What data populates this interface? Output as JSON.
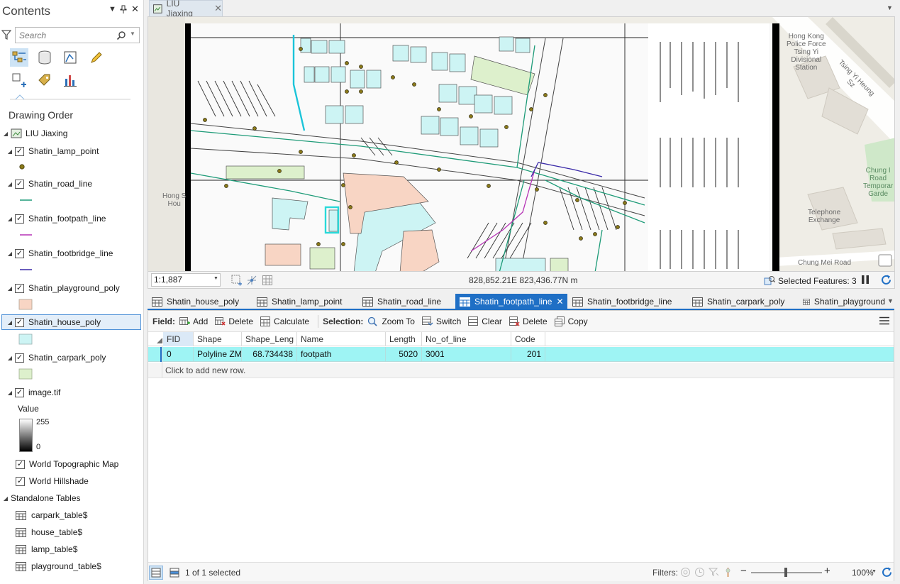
{
  "contents": {
    "title": "Contents",
    "search_placeholder": "Search",
    "drawing_order_label": "Drawing Order",
    "map_name": "LIU Jiaxing",
    "layers": [
      {
        "label": "Shatin_lamp_point",
        "checked": true,
        "symbol": "point",
        "color": "#8b7a1a"
      },
      {
        "label": "Shatin_road_line",
        "checked": true,
        "symbol": "line",
        "color": "#1e9b78"
      },
      {
        "label": "Shatin_footpath_line",
        "checked": true,
        "symbol": "line",
        "color": "#b532b5"
      },
      {
        "label": "Shatin_footbridge_line",
        "checked": true,
        "symbol": "line",
        "color": "#3a2aa8"
      },
      {
        "label": "Shatin_playground_poly",
        "checked": true,
        "symbol": "fill",
        "color": "#f8d5c4"
      },
      {
        "label": "Shatin_house_poly",
        "checked": true,
        "symbol": "fill",
        "color": "#cdf4f4",
        "selected": true
      },
      {
        "label": "Shatin_carpark_poly",
        "checked": true,
        "symbol": "fill",
        "color": "#ddf0cc"
      },
      {
        "label": "image.tif",
        "checked": true,
        "symbol": "raster"
      }
    ],
    "raster_legend": {
      "title": "Value",
      "high": "255",
      "low": "0"
    },
    "basemaps": [
      {
        "label": "World Topographic Map",
        "checked": true
      },
      {
        "label": "World Hillshade",
        "checked": true
      }
    ],
    "standalone_tables_label": "Standalone Tables",
    "tables": [
      "carpark_table$",
      "house_table$",
      "lamp_table$",
      "playground_table$"
    ]
  },
  "map": {
    "tab_label": "LIU Jiaxing",
    "scale": "1:1,887",
    "coordinates": "828,852.21E 823,436.77N m",
    "selected_features": "Selected Features: 3",
    "labels": {
      "police": "Hong Kong\nPolice Force\nTsing Yi\nDivisional\nStation",
      "street": "Tsing Yi Heung Sz",
      "telephone": "Telephone\nExchange",
      "garden": "Chung I\nRoad\nTemporar\nGarde",
      "hong": "Hong S\nHou",
      "chung_mei": "Chung Mei Road"
    },
    "colors": {
      "road": "#1e9b78",
      "footpath": "#b532b5",
      "footbridge": "#3a2aa8",
      "lamp": "#8b7a1a",
      "house": "#cdf4f4",
      "playground": "#f8d5c4",
      "carpark": "#ddf0cc"
    }
  },
  "table_tabs": [
    {
      "label": "Shatin_house_poly"
    },
    {
      "label": "Shatin_lamp_point"
    },
    {
      "label": "Shatin_road_line"
    },
    {
      "label": "Shatin_footpath_line",
      "active": true
    },
    {
      "label": "Shatin_footbridge_line"
    },
    {
      "label": "Shatin_carpark_poly"
    },
    {
      "label": "Shatin_playground"
    }
  ],
  "attribute_table": {
    "toolbar": {
      "field_label": "Field:",
      "add": "Add",
      "delete_field": "Delete",
      "calculate": "Calculate",
      "selection_label": "Selection:",
      "zoom_to": "Zoom To",
      "switch": "Switch",
      "clear": "Clear",
      "delete_sel": "Delete",
      "copy": "Copy"
    },
    "columns": [
      "FID",
      "Shape",
      "Shape_Leng",
      "Name",
      "Length",
      "No_of_line",
      "Code"
    ],
    "rows": [
      {
        "FID": "0",
        "Shape": "Polyline ZM",
        "Shape_Leng": "68.734438",
        "Name": "footpath",
        "Length": "5020",
        "No_of_line": "3001",
        "Code": "201"
      }
    ],
    "add_row_text": "Click to add new row.",
    "footer": {
      "selection_count": "1 of 1 selected",
      "filters_label": "Filters:",
      "zoom": "100%"
    }
  }
}
